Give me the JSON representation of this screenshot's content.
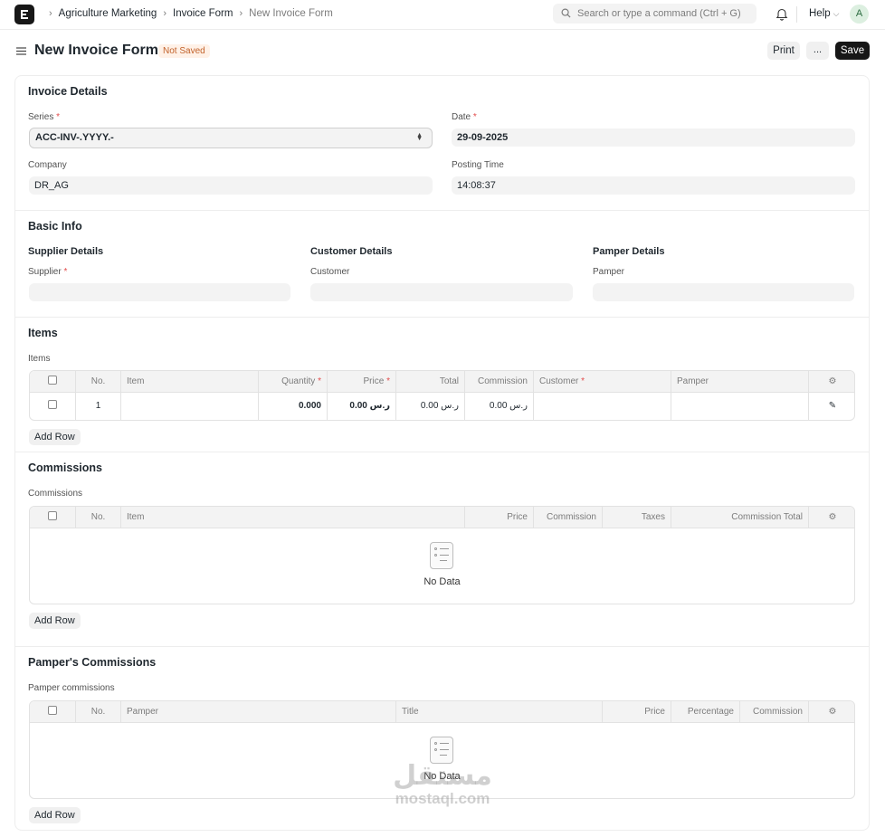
{
  "navbar": {
    "breadcrumbs": [
      "Agriculture Marketing",
      "Invoice Form",
      "New Invoice Form"
    ],
    "search_placeholder": "Search or type a command (Ctrl + G)",
    "help_label": "Help",
    "avatar_initial": "A"
  },
  "header": {
    "title": "New Invoice Form",
    "status": "Not Saved",
    "print_label": "Print",
    "more_label": "...",
    "save_label": "Save"
  },
  "invoice_details": {
    "title": "Invoice Details",
    "series_label": "Series",
    "series_value": "ACC-INV-.YYYY.-",
    "date_label": "Date",
    "date_value": "29-09-2025",
    "company_label": "Company",
    "company_value": "DR_AG",
    "posting_time_label": "Posting Time",
    "posting_time_value": "14:08:37"
  },
  "basic_info": {
    "title": "Basic Info",
    "supplier_details": "Supplier Details",
    "supplier_label": "Supplier",
    "customer_details": "Customer Details",
    "customer_label": "Customer",
    "pamper_details": "Pamper Details",
    "pamper_label": "Pamper"
  },
  "items": {
    "title": "Items",
    "table_label": "Items",
    "columns": [
      "No.",
      "Item",
      "Quantity",
      "Price",
      "Total",
      "Commission",
      "Customer",
      "Pamper"
    ],
    "rows": [
      {
        "no": "1",
        "item": "",
        "quantity": "0.000",
        "price": "0.00 ر.س",
        "total": "0.00 ر.س",
        "commission": "0.00 ر.س",
        "customer": "",
        "pamper": ""
      }
    ],
    "add_row": "Add Row"
  },
  "commissions": {
    "title": "Commissions",
    "table_label": "Commissions",
    "columns": [
      "No.",
      "Item",
      "Price",
      "Commission",
      "Taxes",
      "Commission Total"
    ],
    "empty_text": "No Data",
    "add_row": "Add Row"
  },
  "pamper_commissions": {
    "title": "Pamper's Commissions",
    "table_label": "Pamper commissions",
    "columns": [
      "No.",
      "Pamper",
      "Title",
      "Price",
      "Percentage",
      "Commission"
    ],
    "empty_text": "No Data",
    "add_row": "Add Row"
  },
  "watermark": {
    "arabic": "مستقل",
    "latin": "mostaql.com"
  },
  "colors": {
    "primary": "#171717",
    "required": "#e24c4c",
    "badge_bg": "#fff1e7",
    "badge_text": "#c2622b"
  }
}
